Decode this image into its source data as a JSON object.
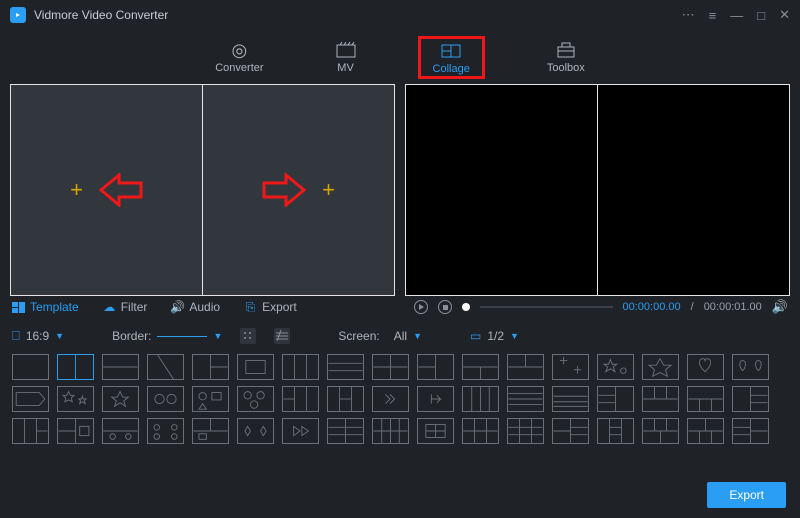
{
  "app": {
    "title": "Vidmore Video Converter"
  },
  "nav": {
    "converter": "Converter",
    "mv": "MV",
    "collage": "Collage",
    "toolbox": "Toolbox"
  },
  "tabs": {
    "template": "Template",
    "filter": "Filter",
    "audio": "Audio",
    "export": "Export"
  },
  "player": {
    "current": "00:00:00.00",
    "total": "00:00:01.00"
  },
  "opts": {
    "ratio": "16:9",
    "border_label": "Border:",
    "screen_label": "Screen:",
    "screen_value": "All",
    "page": "1/2"
  },
  "footer": {
    "export": "Export"
  }
}
